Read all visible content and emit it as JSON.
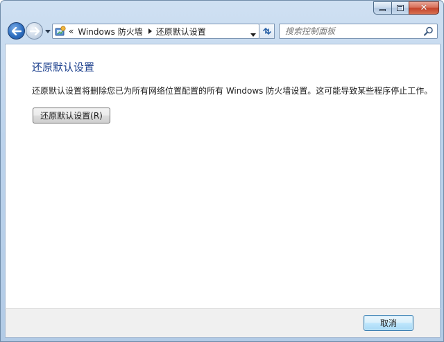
{
  "window": {
    "caption": {
      "minimize_icon": "minimize-icon",
      "maximize_icon": "maximize-icon",
      "close_glyph": "✕"
    }
  },
  "navigation": {
    "back_icon": "back-arrow-icon",
    "forward_icon": "forward-arrow-icon"
  },
  "address_bar": {
    "overflow_chevron": "«",
    "breadcrumbs": [
      "Windows 防火墙",
      "还原默认设置"
    ]
  },
  "search": {
    "placeholder": "搜索控制面板"
  },
  "content": {
    "title": "还原默认设置",
    "description": "还原默认设置将删除您已为所有网络位置配置的所有 Windows 防火墙设置。这可能导致某些程序停止工作。",
    "restore_button_label": "还原默认设置(R)"
  },
  "footer": {
    "cancel_label": "取消"
  },
  "colors": {
    "title_blue": "#1a3e8c",
    "chrome_blue": "#bcd3ec",
    "close_red": "#c4432b"
  }
}
